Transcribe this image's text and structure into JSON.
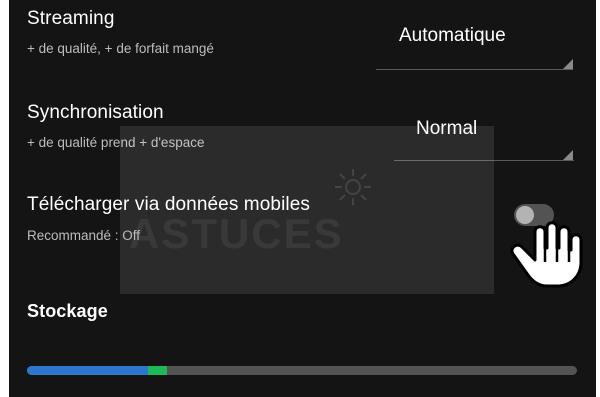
{
  "streaming": {
    "title": "Streaming",
    "subtitle": "+ de qualité, + de forfait mangé",
    "value": "Automatique"
  },
  "sync": {
    "title": "Synchronisation",
    "subtitle": "+ de qualité prend + d'espace",
    "value": "Normal"
  },
  "mobile_data": {
    "title": "Télécharger via données mobiles",
    "subtitle": "Recommandé : Off",
    "enabled": false
  },
  "watermark": "ASTUCES",
  "storage": {
    "title": "Stockage",
    "segments": [
      {
        "name": "blue",
        "color": "#2e77d0",
        "fraction": 0.22
      },
      {
        "name": "green",
        "color": "#1db954",
        "fraction": 0.035
      }
    ]
  },
  "icons": [
    "hand-pointer-icon",
    "dropdown-arrow-icon",
    "sun-icon"
  ]
}
